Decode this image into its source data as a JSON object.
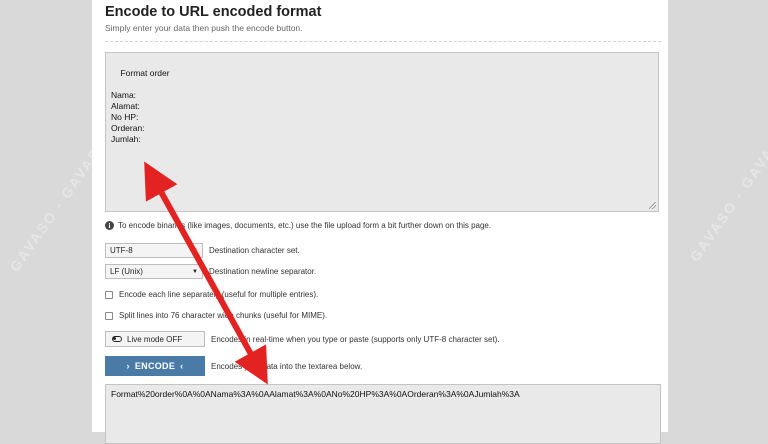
{
  "page": {
    "title": "Encode to URL encoded format",
    "subtitle": "Simply enter your data then push the encode button."
  },
  "input": {
    "value": "Format order\n\nNama:\nAlamat:\nNo HP:\nOrderan:\nJumlah:"
  },
  "info": {
    "text": "To encode binaries (like images, documents, etc.) use the file upload form a bit further down on this page."
  },
  "options": {
    "charset": {
      "value": "UTF-8",
      "label": "Destination character set."
    },
    "newline": {
      "value": "LF (Unix)",
      "label": "Destination newline separator."
    },
    "each_line": {
      "label": "Encode each line separately (useful for multiple entries)."
    },
    "split_lines": {
      "label": "Split lines into 76 character wide chunks (useful for MIME)."
    },
    "live_mode": {
      "button": "Live mode OFF",
      "label": "Encodes in real-time when you type or paste (supports only UTF-8 character set)."
    },
    "encode": {
      "button": "ENCODE",
      "label": "Encodes your data into the textarea below."
    }
  },
  "output": {
    "value": "Format%20order%0A%0ANama%3A%0AAlamat%3A%0ANo%20HP%3A%0AOrderan%3A%0AJumlah%3A"
  },
  "watermark": "GAVASO - GAVASO - GAVASO",
  "colors": {
    "encode_button": "#4a7ba7",
    "arrow": "#e32222",
    "textarea_bg": "#e9e9e9",
    "backdrop": "#d9d9d9"
  }
}
